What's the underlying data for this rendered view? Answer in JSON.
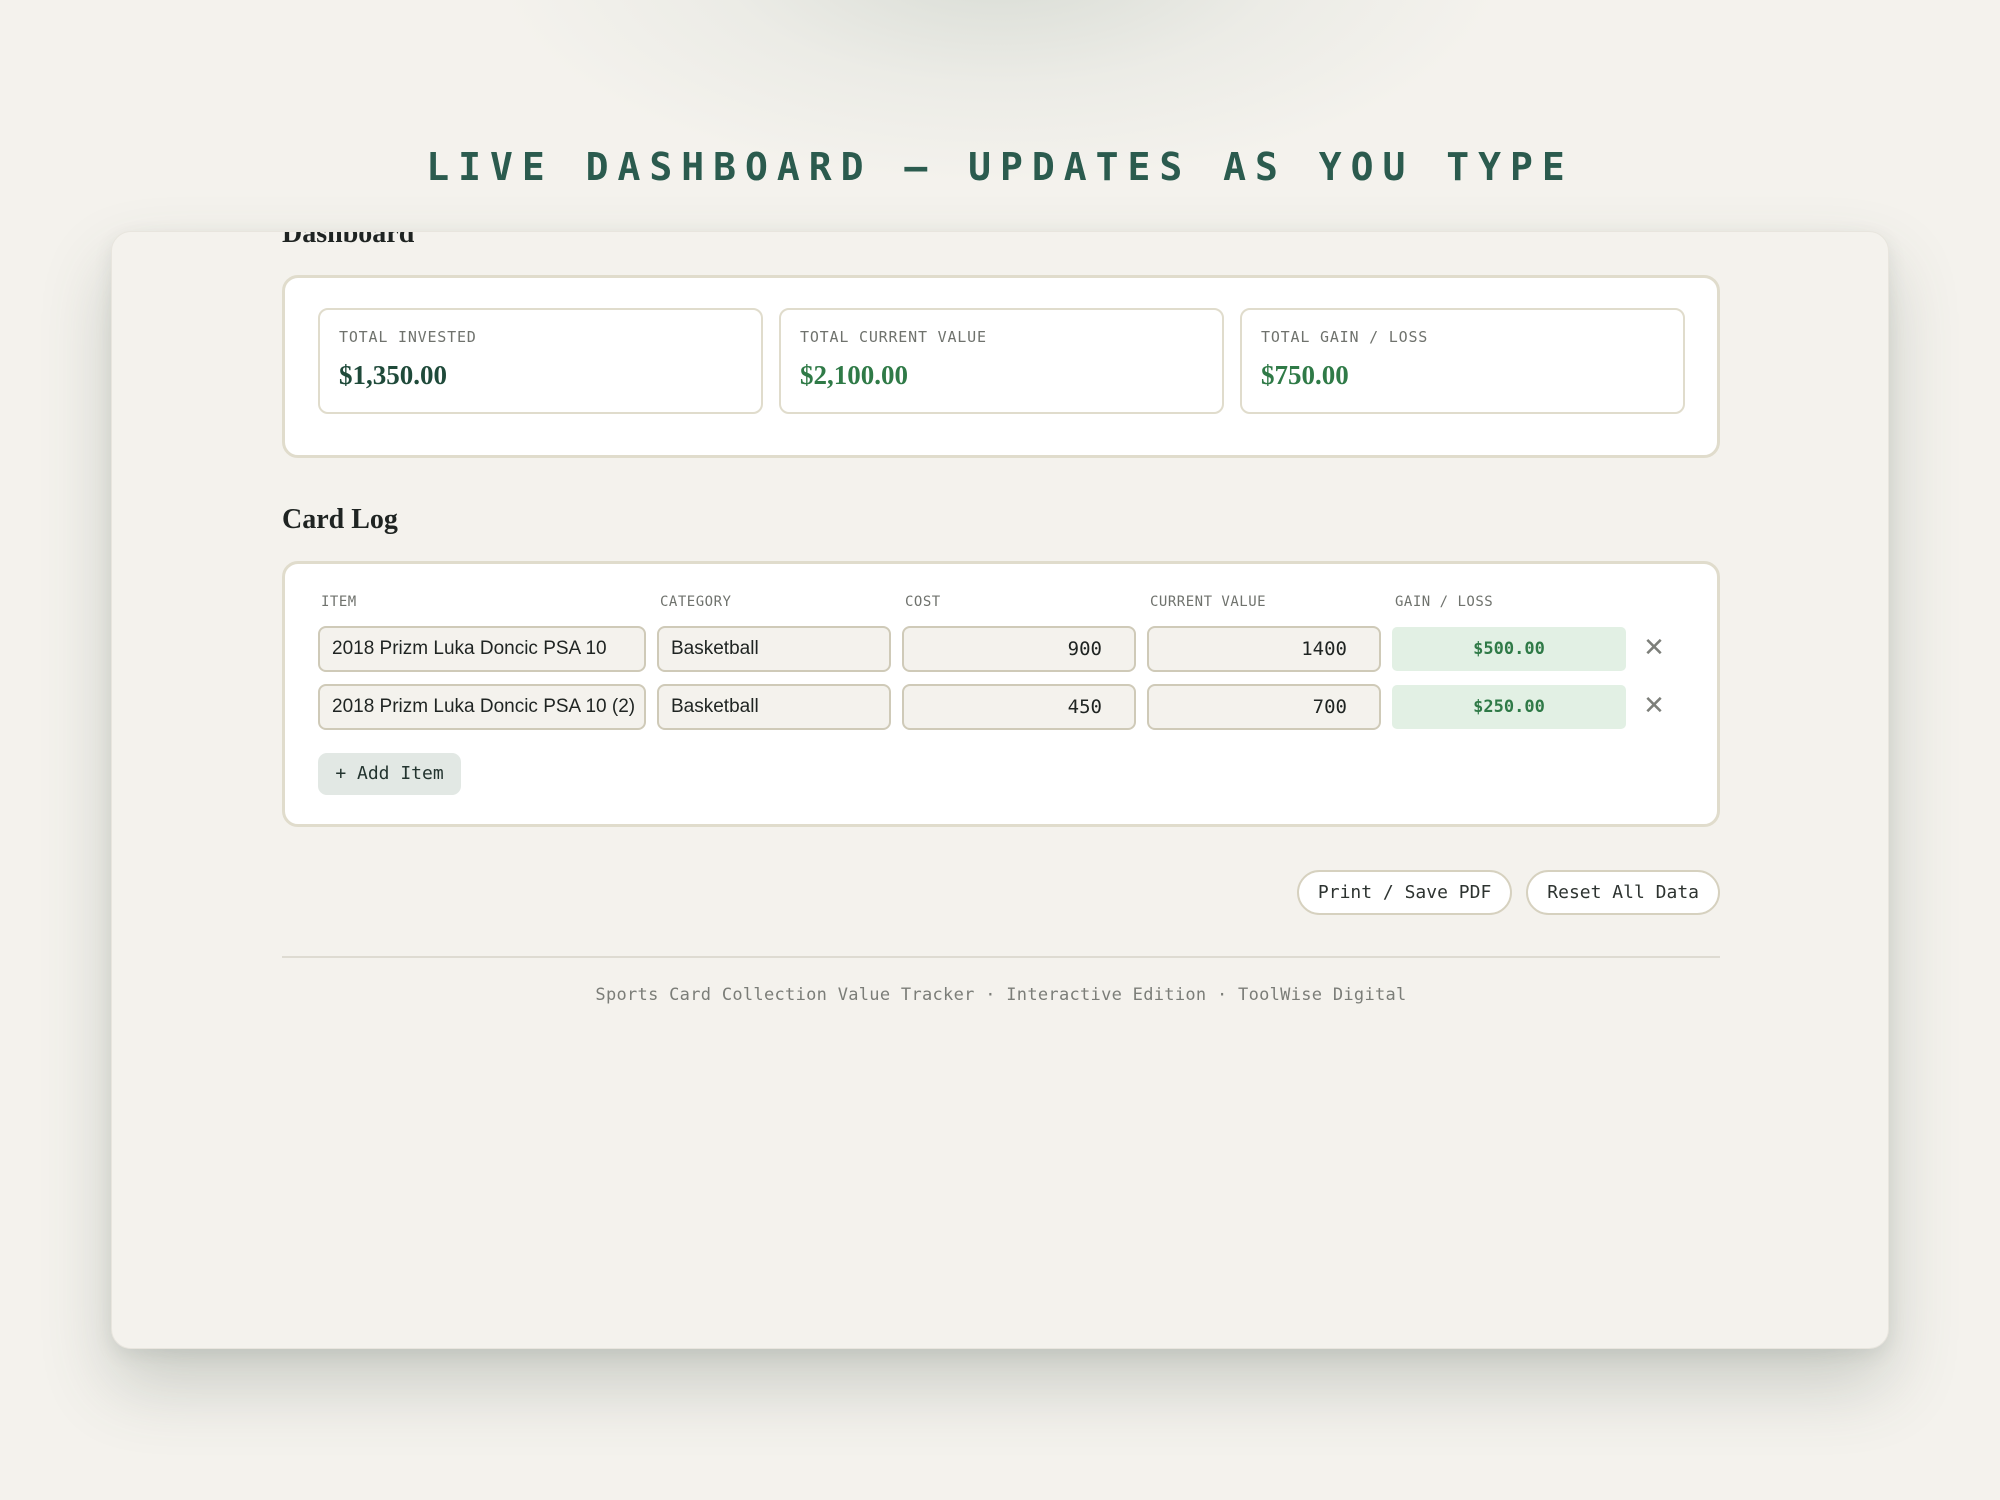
{
  "banner": "LIVE DASHBOARD — UPDATES AS YOU TYPE",
  "dashboard": {
    "title": "Dashboard",
    "stats": [
      {
        "label": "TOTAL INVESTED",
        "value": "$1,350.00"
      },
      {
        "label": "TOTAL CURRENT VALUE",
        "value": "$2,100.00"
      },
      {
        "label": "TOTAL GAIN / LOSS",
        "value": "$750.00"
      }
    ]
  },
  "card_log": {
    "title": "Card Log",
    "columns": {
      "item": "ITEM",
      "category": "CATEGORY",
      "cost": "COST",
      "current_value": "CURRENT VALUE",
      "gain_loss": "GAIN / LOSS"
    },
    "rows": [
      {
        "item": "2018 Prizm Luka Doncic PSA 10",
        "category": "Basketball",
        "cost": "900",
        "current_value": "1400",
        "gain_loss": "$500.00",
        "remove": "✕"
      },
      {
        "item": "2018 Prizm Luka Doncic PSA 10 (2)",
        "category": "Basketball",
        "cost": "450",
        "current_value": "700",
        "gain_loss": "$250.00",
        "remove": "✕"
      }
    ],
    "add_label": "+ Add Item"
  },
  "actions": {
    "print_label": "Print / Save PDF",
    "reset_label": "Reset All Data"
  },
  "footer": "Sports Card Collection Value Tracker · Interactive Edition · ToolWise Digital",
  "colors": {
    "accent_dark_green": "#2b5b4e",
    "gain_green": "#2f7a47",
    "gain_bg": "#e2f0e4",
    "page_bg": "#f4f2ed"
  },
  "icons": {
    "remove_row": "close-icon"
  }
}
